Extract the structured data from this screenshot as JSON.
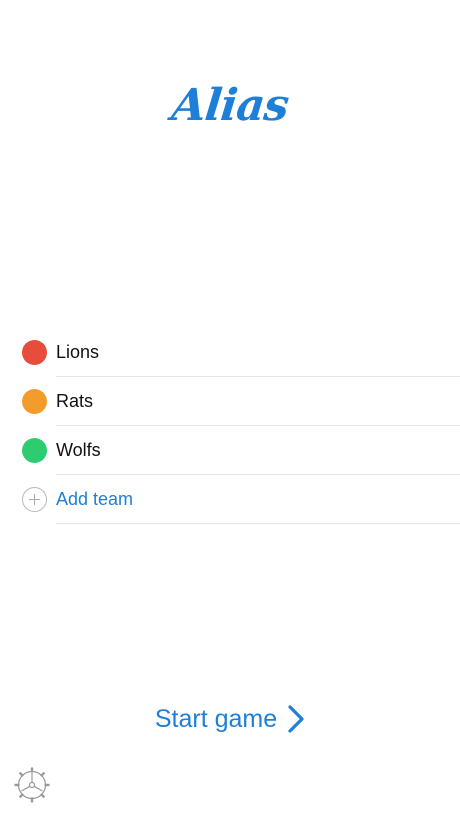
{
  "app": {
    "logo_text": "Alias",
    "accent_color": "#1e7fd8"
  },
  "teams": [
    {
      "name": "Lions",
      "color": "#e74c3c"
    },
    {
      "name": "Rats",
      "color": "#f39c2b"
    },
    {
      "name": "Wolfs",
      "color": "#2ecc71"
    }
  ],
  "add_team": {
    "label": "Add team",
    "icon": "plus-circle-icon"
  },
  "start": {
    "label": "Start game",
    "icon": "chevron-right-icon"
  },
  "settings": {
    "icon": "gear-icon"
  }
}
